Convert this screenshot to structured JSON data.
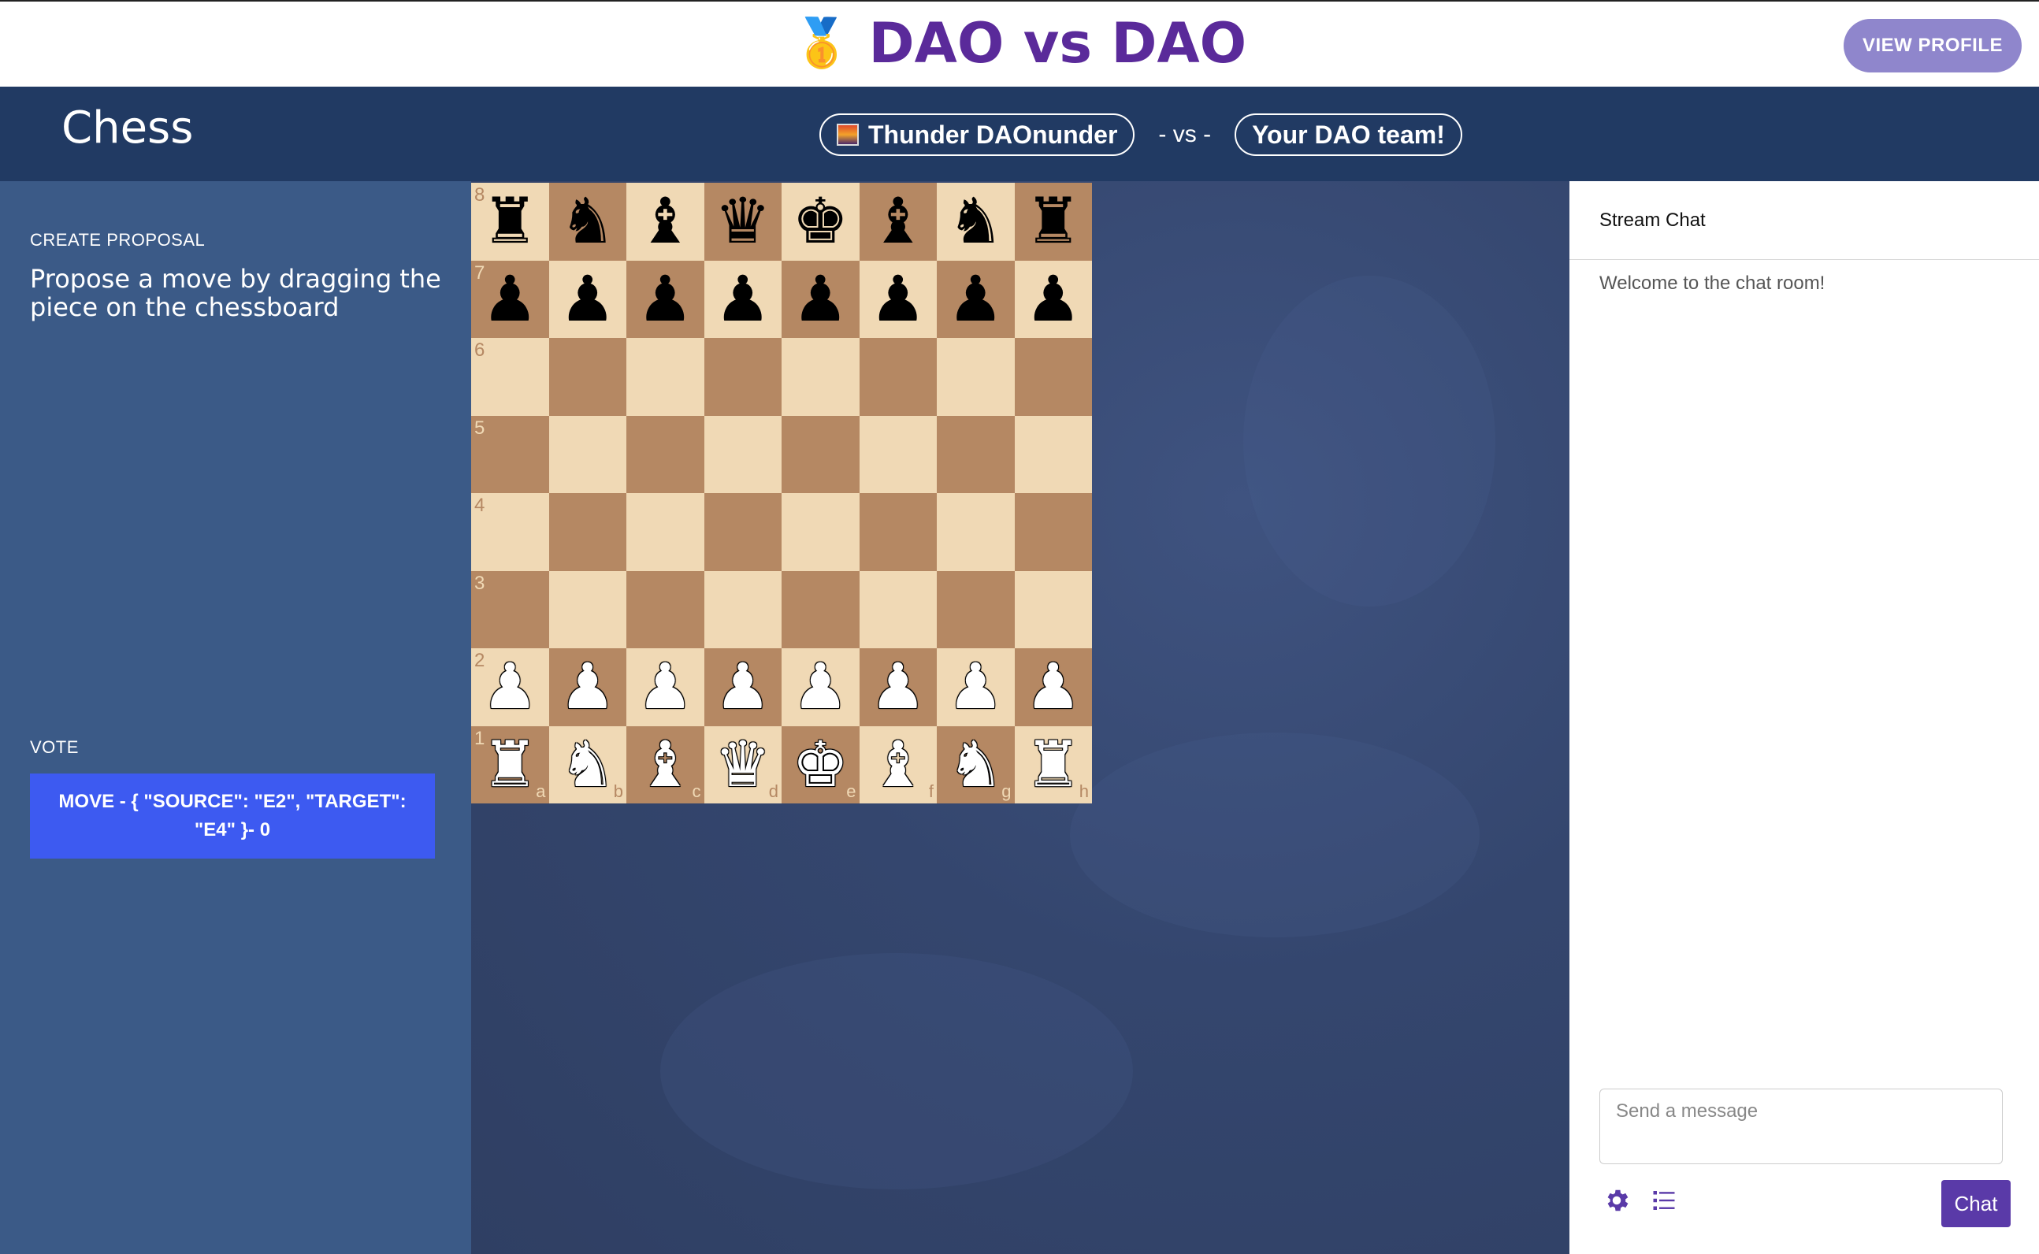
{
  "topbar": {
    "brand_icon": "medal-icon",
    "brand_emoji": "🥇",
    "brand_title": "DAO vs DAO",
    "profile_button": "VIEW PROFILE",
    "brand_color": "#5a2a9a",
    "profile_button_color": "#8f86cc"
  },
  "header": {
    "game_title": "Chess",
    "team_left": "Thunder DAOnunder",
    "vs_label": "- vs -",
    "team_right": "Your DAO team!",
    "background_color": "#213a63"
  },
  "left_panel": {
    "create_label": "CREATE PROPOSAL",
    "propose_text": "Propose a move by dragging the piece on the chessboard",
    "vote_label": "VOTE",
    "vote_option": "MOVE - { \"SOURCE\": \"E2\", \"TARGET\": \"E4\" }- 0",
    "vote_button_color": "#3d5af1"
  },
  "board": {
    "light_color": "#f0d9b5",
    "dark_color": "#b58863",
    "ranks": [
      "8",
      "7",
      "6",
      "5",
      "4",
      "3",
      "2",
      "1"
    ],
    "files": [
      "a",
      "b",
      "c",
      "d",
      "e",
      "f",
      "g",
      "h"
    ],
    "position": [
      [
        "r",
        "n",
        "b",
        "q",
        "k",
        "b",
        "n",
        "r"
      ],
      [
        "p",
        "p",
        "p",
        "p",
        "p",
        "p",
        "p",
        "p"
      ],
      [
        "",
        "",
        "",
        "",
        "",
        "",
        "",
        ""
      ],
      [
        "",
        "",
        "",
        "",
        "",
        "",
        "",
        ""
      ],
      [
        "",
        "",
        "",
        "",
        "",
        "",
        "",
        ""
      ],
      [
        "",
        "",
        "",
        "",
        "",
        "",
        "",
        ""
      ],
      [
        "P",
        "P",
        "P",
        "P",
        "P",
        "P",
        "P",
        "P"
      ],
      [
        "R",
        "N",
        "B",
        "Q",
        "K",
        "B",
        "N",
        "R"
      ]
    ]
  },
  "chat": {
    "title": "Stream Chat",
    "welcome": "Welcome to the chat room!",
    "input_placeholder": "Send a message",
    "send_label": "Chat",
    "settings_icon": "gear-icon",
    "list_icon": "list-icon",
    "accent_color": "#5a3aa8"
  }
}
